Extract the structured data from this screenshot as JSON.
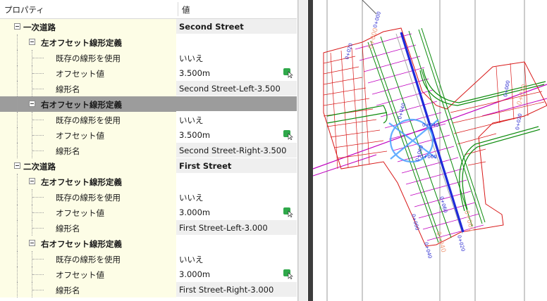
{
  "panel": {
    "header": {
      "property": "プロパティ",
      "value": "値"
    },
    "rows": [
      {
        "level": 0,
        "label": "一次道路",
        "value": "Second Street",
        "kind": "cat"
      },
      {
        "level": 1,
        "label": "左オフセット線形定義",
        "value": "",
        "kind": "sub"
      },
      {
        "level": 2,
        "label": "既存の線形を使用",
        "value": "いいえ",
        "kind": "item"
      },
      {
        "level": 2,
        "label": "オフセット値",
        "value": "3.500m",
        "kind": "item-pick"
      },
      {
        "level": 2,
        "label": "線形名",
        "value": "Second Street-Left-3.500",
        "kind": "ro"
      },
      {
        "level": 1,
        "label": "右オフセット線形定義",
        "value": "",
        "kind": "sub-sel"
      },
      {
        "level": 2,
        "label": "既存の線形を使用",
        "value": "いいえ",
        "kind": "item"
      },
      {
        "level": 2,
        "label": "オフセット値",
        "value": "3.500m",
        "kind": "item-pick"
      },
      {
        "level": 2,
        "label": "線形名",
        "value": "Second Street-Right-3.500",
        "kind": "ro"
      },
      {
        "level": 0,
        "label": "二次道路",
        "value": "First Street",
        "kind": "cat"
      },
      {
        "level": 1,
        "label": "左オフセット線形定義",
        "value": "",
        "kind": "sub"
      },
      {
        "level": 2,
        "label": "既存の線形を使用",
        "value": "いいえ",
        "kind": "item"
      },
      {
        "level": 2,
        "label": "オフセット値",
        "value": "3.000m",
        "kind": "item-pick"
      },
      {
        "level": 2,
        "label": "線形名",
        "value": "First Street-Left-3.000",
        "kind": "ro"
      },
      {
        "level": 1,
        "label": "右オフセット線形定義",
        "value": "",
        "kind": "sub"
      },
      {
        "level": 2,
        "label": "既存の線形を使用",
        "value": "いいえ",
        "kind": "item"
      },
      {
        "level": 2,
        "label": "オフセット値",
        "value": "3.000m",
        "kind": "item-pick"
      },
      {
        "level": 2,
        "label": "線形名",
        "value": "First Street-Right-3.000",
        "kind": "ro"
      }
    ]
  },
  "drawing": {
    "station_labels": [
      "0+000",
      "0+020",
      "0+040",
      "0+060",
      "0+000",
      "0+020",
      "0+040",
      "0+060",
      "0+000",
      "0+020",
      "0+040",
      "0+060"
    ],
    "overlay_labels": [
      "0+000",
      "0+020",
      "0+040",
      "0+060"
    ],
    "colors": {
      "centerline": "#1e2bd8",
      "offset": "#0a8a0a",
      "frame": "#d81818",
      "sections": "#c000c0",
      "tracker": "#4aa0ff"
    }
  }
}
